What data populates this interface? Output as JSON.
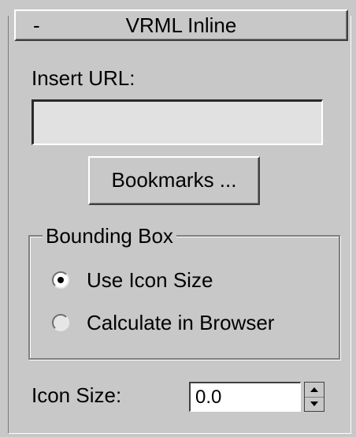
{
  "rollout": {
    "toggle_symbol": "-",
    "title": "VRML Inline"
  },
  "insert_url": {
    "label": "Insert URL:",
    "value": ""
  },
  "bookmarks_button": {
    "label": "Bookmarks ..."
  },
  "bounding_box": {
    "legend": "Bounding Box",
    "options": [
      {
        "label": "Use Icon Size",
        "checked": true
      },
      {
        "label": "Calculate in Browser",
        "checked": false
      }
    ]
  },
  "icon_size": {
    "label": "Icon Size:",
    "value": "0.0"
  }
}
